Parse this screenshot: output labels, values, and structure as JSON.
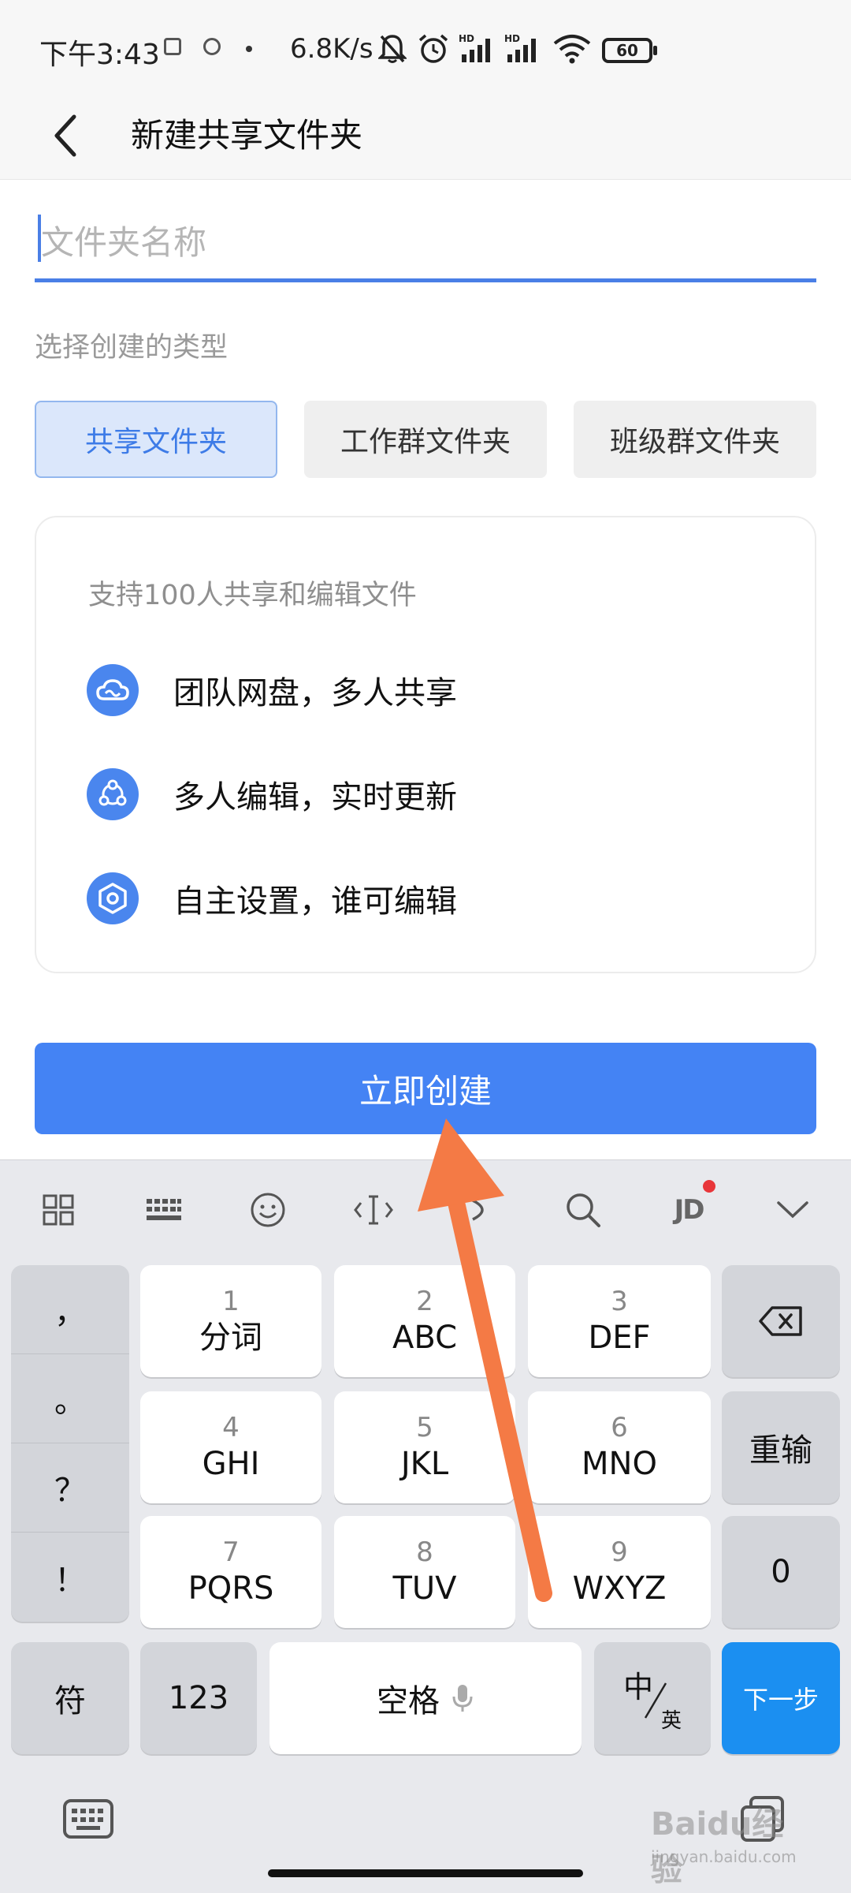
{
  "status_bar": {
    "time": "下午3:43",
    "net_speed": "6.8K/s",
    "battery": "60",
    "network_badge_1": "HD",
    "network_badge_2": "HD"
  },
  "header": {
    "title": "新建共享文件夹",
    "back_icon": "chevron-left-icon"
  },
  "form": {
    "name_placeholder": "文件夹名称",
    "name_value": "",
    "type_label": "选择创建的类型",
    "types": [
      {
        "label": "共享文件夹",
        "selected": true
      },
      {
        "label": "工作群文件夹",
        "selected": false
      },
      {
        "label": "班级群文件夹",
        "selected": false
      }
    ]
  },
  "info_card": {
    "headline": "支持100人共享和编辑文件",
    "features": [
      {
        "icon": "cloud-icon",
        "text": "团队网盘，多人共享"
      },
      {
        "icon": "collaborate-icon",
        "text": "多人编辑，实时更新"
      },
      {
        "icon": "settings-hex-icon",
        "text": "自主设置，谁可编辑"
      }
    ]
  },
  "create_button": "立即创建",
  "keyboard": {
    "toolbar": [
      "grid-icon",
      "keyboard-icon",
      "emoji-icon",
      "cursor-icon",
      "voice-icon",
      "search-icon",
      "jd-icon",
      "collapse-icon"
    ],
    "jd_label": "JD",
    "punctuation": [
      "，",
      "。",
      "？",
      "！"
    ],
    "keys": [
      {
        "num": "1",
        "letters": "分词"
      },
      {
        "num": "2",
        "letters": "ABC"
      },
      {
        "num": "3",
        "letters": "DEF"
      },
      {
        "num": "4",
        "letters": "GHI"
      },
      {
        "num": "5",
        "letters": "JKL"
      },
      {
        "num": "6",
        "letters": "MNO"
      },
      {
        "num": "7",
        "letters": "PQRS"
      },
      {
        "num": "8",
        "letters": "TUV"
      },
      {
        "num": "9",
        "letters": "WXYZ"
      }
    ],
    "reenter": "重输",
    "zero": "0",
    "symbol": "符",
    "num_switch": "123",
    "space": "空格",
    "zh": "中",
    "en": "英",
    "next": "下一步"
  },
  "watermark": {
    "logo": "Baidu经验",
    "url": "jingyan.baidu.com"
  },
  "colors": {
    "accent": "#4483f4",
    "selected_bg": "#dbe7fb",
    "keyboard_bg": "#e8e9ed",
    "next_key": "#1b8ff1",
    "arrow": "#f47a45"
  }
}
